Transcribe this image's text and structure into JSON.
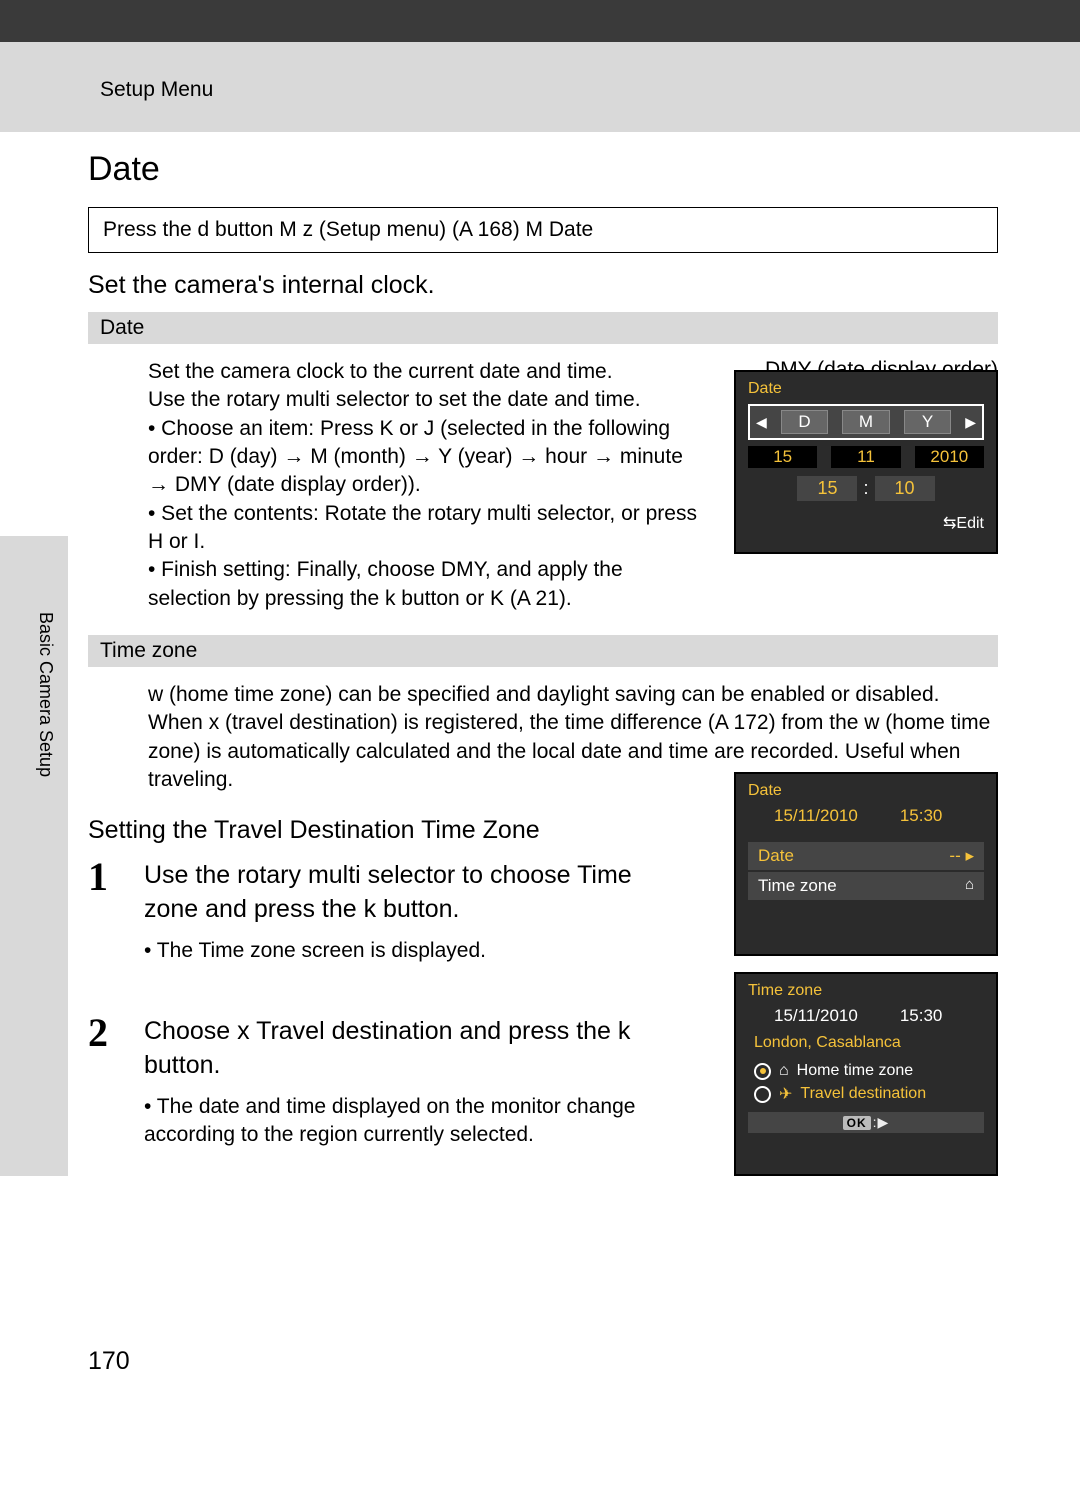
{
  "header": {
    "breadcrumb": "Setup Menu",
    "sideTab": "Basic Camera Setup"
  },
  "title": "Date",
  "breadcrumbLine": "Press the d button M z (Setup menu) (A 168) M Date",
  "lead": "Set the camera's internal clock.",
  "dateSection": {
    "heading": "Date",
    "body": "Set the camera clock to the current date and time.\nUse the rotary multi selector to set the date and time.\n• Choose an item: Press K or J (selected in the following order: D (day) → M (month) → Y (year) → hour → minute → DMY (date display order)).\n• Set the contents: Rotate the rotary multi selector, or press H or I.\n• Finish setting: Finally, choose DMY, and apply the selection by pressing the k button or K (A 21).",
    "floatLabel": "DMY (date display order)"
  },
  "tzSection": {
    "heading": "Time zone",
    "body": "w (home time zone) can be specified and daylight saving can be enabled or disabled.\nWhen x (travel destination) is registered, the time difference (A 172) from the w (home time zone) is automatically calculated and the local date and time are recorded. Useful when traveling."
  },
  "subheading": "Setting the Travel Destination Time Zone",
  "step1": {
    "num": "1",
    "title": "Use the rotary multi selector to choose Time zone and press the k button.",
    "note": "• The Time zone screen is displayed."
  },
  "step2": {
    "num": "2",
    "title": "Choose x Travel destination and press the k button.",
    "note": "• The date and time displayed on the monitor change according to the region currently selected."
  },
  "lcd1": {
    "title": "Date",
    "D": "D",
    "M": "M",
    "Y": "Y",
    "day": "15",
    "month": "11",
    "year": "2010",
    "hour": "15",
    "minute": "10",
    "edit": "Edit"
  },
  "lcd2": {
    "title": "Date",
    "date": "15/11/2010",
    "time": "15:30",
    "item1": "Date",
    "item2": "Time zone"
  },
  "lcd3": {
    "title": "Time zone",
    "date": "15/11/2010",
    "time": "15:30",
    "region": "London, Casablanca",
    "opt1": "Home time zone",
    "opt2": "Travel destination",
    "ok": "OK"
  },
  "pageNumber": "170"
}
